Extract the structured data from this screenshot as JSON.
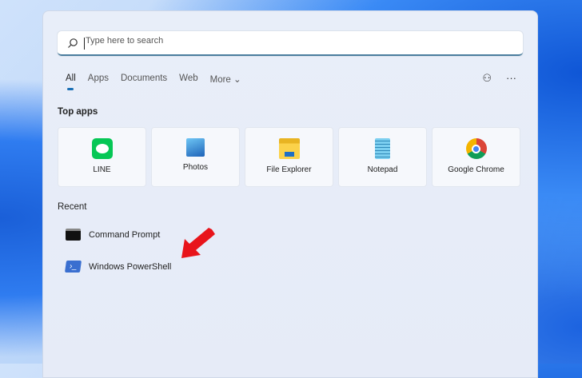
{
  "search": {
    "placeholder": "Type here to search"
  },
  "tabs": [
    {
      "label": "All"
    },
    {
      "label": "Apps"
    },
    {
      "label": "Documents"
    },
    {
      "label": "Web"
    },
    {
      "label": "More ⌄"
    }
  ],
  "top_apps": {
    "heading": "Top apps",
    "items": [
      {
        "label": "LINE",
        "icon": "line-icon",
        "color": "#06c755"
      },
      {
        "label": "Photos",
        "icon": "photos-icon",
        "color": "#2b7cd3"
      },
      {
        "label": "File Explorer",
        "icon": "folder-icon",
        "color": "#f5c518"
      },
      {
        "label": "Notepad",
        "icon": "notepad-icon",
        "color": "#6cc3e8"
      },
      {
        "label": "Google Chrome",
        "icon": "chrome-icon",
        "color": "#db4437"
      }
    ]
  },
  "recent": {
    "heading": "Recent",
    "items": [
      {
        "label": "Command Prompt",
        "icon": "command-prompt-icon"
      },
      {
        "label": "Windows PowerShell",
        "icon": "powershell-icon"
      }
    ]
  },
  "annotation_color": "#e8141b"
}
